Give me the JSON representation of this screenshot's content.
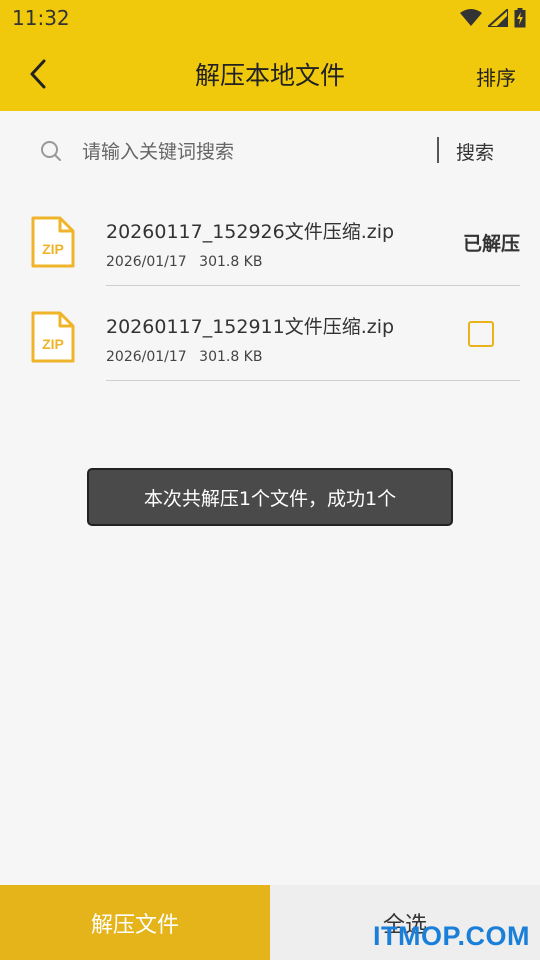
{
  "status_bar": {
    "time": "11:32",
    "icons": [
      "wifi-icon",
      "signal-icon",
      "battery-charging-icon"
    ]
  },
  "app_bar": {
    "title": "解压本地文件",
    "sort_label": "排序",
    "back_icon": "back-arrow-icon",
    "background_color": "#f0c90c"
  },
  "search": {
    "placeholder": "请输入关键词搜索",
    "value": "",
    "button_label": "搜索",
    "icon": "search-icon"
  },
  "files": [
    {
      "name": "20260117_152926文件压缩.zip",
      "date": "2026/01/17",
      "size": "301.8 KB",
      "status_label": "已解压",
      "extracted": true,
      "icon": "zip-file-icon"
    },
    {
      "name": "20260117_152911文件压缩.zip",
      "date": "2026/01/17",
      "size": "301.8 KB",
      "status_label": "",
      "extracted": false,
      "checked": false,
      "icon": "zip-file-icon"
    }
  ],
  "toast": {
    "message": "本次共解压1个文件，成功1个"
  },
  "bottom_bar": {
    "extract_label": "解压文件",
    "select_all_label": "全选",
    "accent_color": "#e4b41a"
  },
  "watermark": {
    "text": "ITMOP.COM"
  }
}
